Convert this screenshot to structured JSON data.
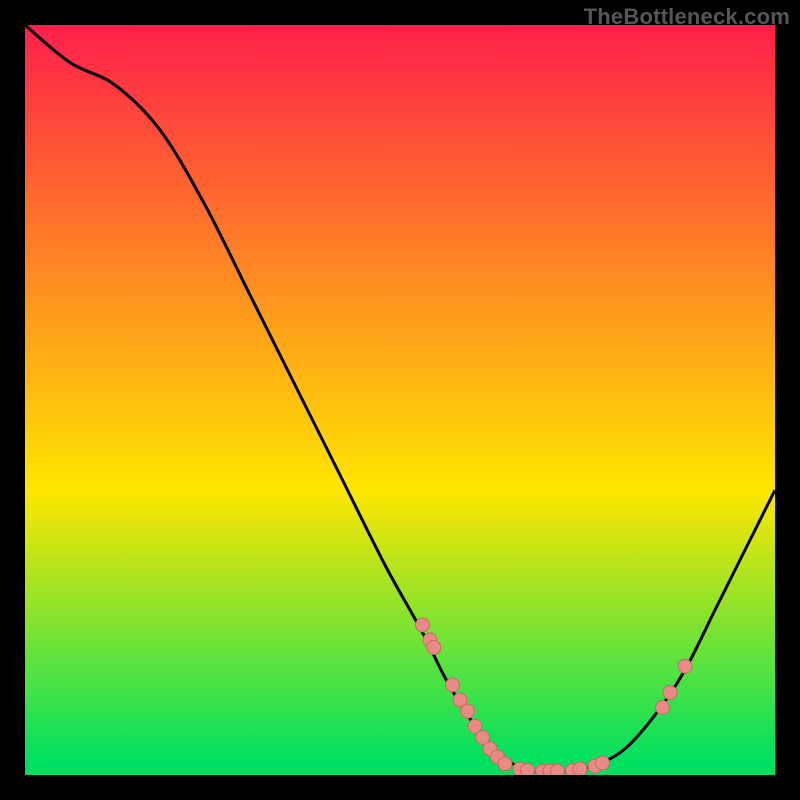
{
  "attribution": "TheBottleneck.com",
  "colors": {
    "gradient_top": "#ff1f4a",
    "gradient_mid": "#ffe600",
    "gradient_bottom": "#00e060",
    "curve": "#000000",
    "marker_fill": "#e88a86",
    "marker_stroke": "#c96861",
    "frame": "#000000"
  },
  "chart_data": {
    "type": "line",
    "title": "",
    "xlabel": "",
    "ylabel": "",
    "xlim": [
      0,
      100
    ],
    "ylim": [
      0,
      100
    ],
    "curve": [
      {
        "x": 0,
        "y": 100
      },
      {
        "x": 6,
        "y": 95
      },
      {
        "x": 12,
        "y": 92
      },
      {
        "x": 18,
        "y": 86
      },
      {
        "x": 24,
        "y": 76
      },
      {
        "x": 30,
        "y": 64
      },
      {
        "x": 36,
        "y": 52
      },
      {
        "x": 42,
        "y": 40
      },
      {
        "x": 48,
        "y": 28
      },
      {
        "x": 53,
        "y": 19
      },
      {
        "x": 56,
        "y": 13
      },
      {
        "x": 59,
        "y": 8
      },
      {
        "x": 62,
        "y": 4
      },
      {
        "x": 65,
        "y": 1.5
      },
      {
        "x": 68,
        "y": 0.5
      },
      {
        "x": 72,
        "y": 0.5
      },
      {
        "x": 76,
        "y": 1.3
      },
      {
        "x": 80,
        "y": 3.5
      },
      {
        "x": 84,
        "y": 8
      },
      {
        "x": 88,
        "y": 14
      },
      {
        "x": 92,
        "y": 22
      },
      {
        "x": 96,
        "y": 30
      },
      {
        "x": 100,
        "y": 38
      }
    ],
    "markers": [
      {
        "x": 53,
        "y": 20
      },
      {
        "x": 54,
        "y": 18
      },
      {
        "x": 54.5,
        "y": 17
      },
      {
        "x": 57,
        "y": 12
      },
      {
        "x": 58,
        "y": 10
      },
      {
        "x": 59,
        "y": 8.5
      },
      {
        "x": 60,
        "y": 6.5
      },
      {
        "x": 61,
        "y": 5
      },
      {
        "x": 62,
        "y": 3.5
      },
      {
        "x": 63,
        "y": 2.4
      },
      {
        "x": 64,
        "y": 1.5
      },
      {
        "x": 66,
        "y": 0.8
      },
      {
        "x": 67,
        "y": 0.6
      },
      {
        "x": 69,
        "y": 0.5
      },
      {
        "x": 70,
        "y": 0.5
      },
      {
        "x": 71,
        "y": 0.5
      },
      {
        "x": 73,
        "y": 0.6
      },
      {
        "x": 74,
        "y": 0.8
      },
      {
        "x": 76,
        "y": 1.2
      },
      {
        "x": 77,
        "y": 1.6
      },
      {
        "x": 85,
        "y": 9
      },
      {
        "x": 86,
        "y": 11
      },
      {
        "x": 88,
        "y": 14.5
      }
    ]
  }
}
